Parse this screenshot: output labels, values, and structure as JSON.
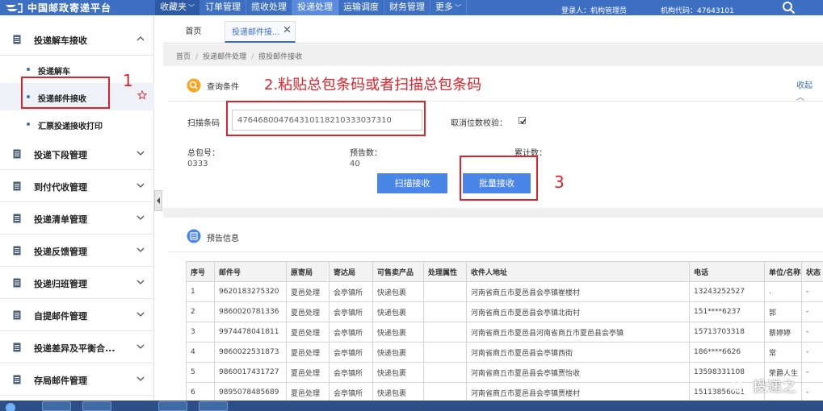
{
  "topbar": {
    "logo_text": "中国邮政寄递平台",
    "nav": [
      {
        "label": "收藏夹",
        "caret": true
      },
      {
        "label": "订单管理"
      },
      {
        "label": "揽收处理"
      },
      {
        "label": "投递处理"
      },
      {
        "label": "运输调度"
      },
      {
        "label": "财务管理"
      },
      {
        "label": "更多",
        "caret": true
      }
    ],
    "user_info": "登录人：机构管理员",
    "org_info": "机构代码：47643101"
  },
  "sidebar": {
    "groups": [
      {
        "label": "投递解车接收"
      },
      {
        "label": "投递下段管理"
      },
      {
        "label": "到付代收管理"
      },
      {
        "label": "投递清单管理"
      },
      {
        "label": "投递反馈管理"
      },
      {
        "label": "投递归班管理"
      },
      {
        "label": "自提邮件管理"
      },
      {
        "label": "投递差异及平衡合..."
      },
      {
        "label": "存局邮件管理"
      }
    ],
    "sub_items": [
      {
        "label": "投递解车"
      },
      {
        "label": "投递邮件接收"
      },
      {
        "label": "汇票投递接收打印"
      }
    ]
  },
  "tabs": {
    "home": "首页",
    "current": "投递邮件接..."
  },
  "breadcrumb": [
    "首页",
    "投递邮件处理",
    "揽投邮件接收"
  ],
  "query": {
    "title": "查询条件",
    "collapse": "收起",
    "scan_label": "扫描条码",
    "scan_value": "476468004764310118210333037310",
    "checkbox_label": "取消位数校验：",
    "checkbox_checked": true,
    "total_bag_label": "总包号：",
    "total_bag_value": "0333",
    "forecast_label": "预告数：",
    "forecast_value": "40",
    "cumulative_label": "累计数：",
    "cumulative_value": "",
    "scan_button": "扫描接收",
    "batch_button": "批量接收"
  },
  "annotations": {
    "one": "1",
    "two": "2.粘贴总包条码或者扫描总包条码",
    "three": "3"
  },
  "forecast_info": {
    "title": "预告信息",
    "columns": [
      "序号",
      "邮件号",
      "原寄局",
      "寄达局",
      "可售卖产品",
      "处理属性",
      "收件人地址",
      "电话",
      "单位/名称",
      "状态"
    ],
    "rows": [
      [
        "1",
        "9620183275320",
        "夏邑处理",
        "会亭镇所",
        "快递包裹",
        "",
        "河南省商丘市夏邑县会亭镇崔楼村",
        "13243252527",
        ".",
        "-"
      ],
      [
        "2",
        "9860020781336",
        "夏邑处理",
        "会亭镇所",
        "快递包裹",
        "",
        "河南省商丘市夏邑县会亭镇北街村",
        "151****6237",
        "郭",
        "-"
      ],
      [
        "3",
        "9974478041811",
        "夏邑处理",
        "会亭镇所",
        "快递包裹",
        "",
        "河南省商丘市夏邑县河南省商丘市夏邑县会亭镇",
        "15713703318",
        "蔡婷婷",
        "-"
      ],
      [
        "4",
        "9860022531873",
        "夏邑处理",
        "会亭镇所",
        "快递包裹",
        "",
        "河南省商丘市夏邑县会亭镇西街",
        "186****6626",
        "常",
        "-"
      ],
      [
        "5",
        "9860017431727",
        "夏邑处理",
        "会亭镇所",
        "快递包裹",
        "",
        "河南省商丘市夏邑县会亭镇贾怡收",
        "13598331108",
        "荣爵人生",
        "-"
      ],
      [
        "6",
        "9895078485689",
        "夏邑处理",
        "会亭镇所",
        "快递包裹",
        "",
        "河南省商丘市夏邑县会亭镇贾楼村",
        "15113856081",
        "",
        "-"
      ]
    ]
  },
  "watermark": "投递之",
  "colors": {
    "brand": "#3d6fc2",
    "button": "#4a86e8",
    "annotation": "#e1222a"
  }
}
